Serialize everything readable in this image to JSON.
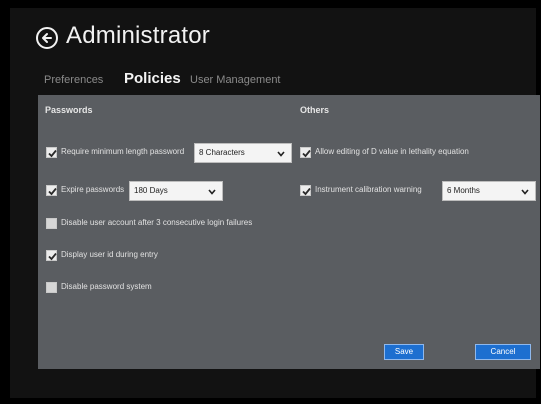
{
  "header": {
    "title": "Administrator",
    "back_icon": "back-arrow-circle-icon"
  },
  "tabs": [
    {
      "label": "Preferences",
      "active": false
    },
    {
      "label": "Policies",
      "active": true
    },
    {
      "label": "User Management",
      "active": false
    }
  ],
  "passwords": {
    "heading": "Passwords",
    "min_length": {
      "label": "Require minimum length password",
      "checked": true,
      "value": "8 Characters"
    },
    "expire": {
      "label": "Expire passwords",
      "checked": true,
      "value": "180 Days"
    },
    "disable_account": {
      "label": "Disable user account after 3 consecutive login failures",
      "checked": false
    },
    "display_last": {
      "label": "Display user id during entry",
      "checked": true
    },
    "disable_system": {
      "label": "Disable password system",
      "checked": false
    }
  },
  "others": {
    "heading": "Others",
    "allow_editing": {
      "label": "Allow editing of D value in lethality equation",
      "checked": true
    },
    "calibration_warning": {
      "label": "Instrument calibration warning",
      "checked": true,
      "value": "6 Months"
    }
  },
  "buttons": {
    "save": "Save",
    "cancel": "Cancel"
  },
  "colors": {
    "app_background": "#121212",
    "panel_background": "#5a5d61",
    "accent_button": "#1d6fd0"
  }
}
